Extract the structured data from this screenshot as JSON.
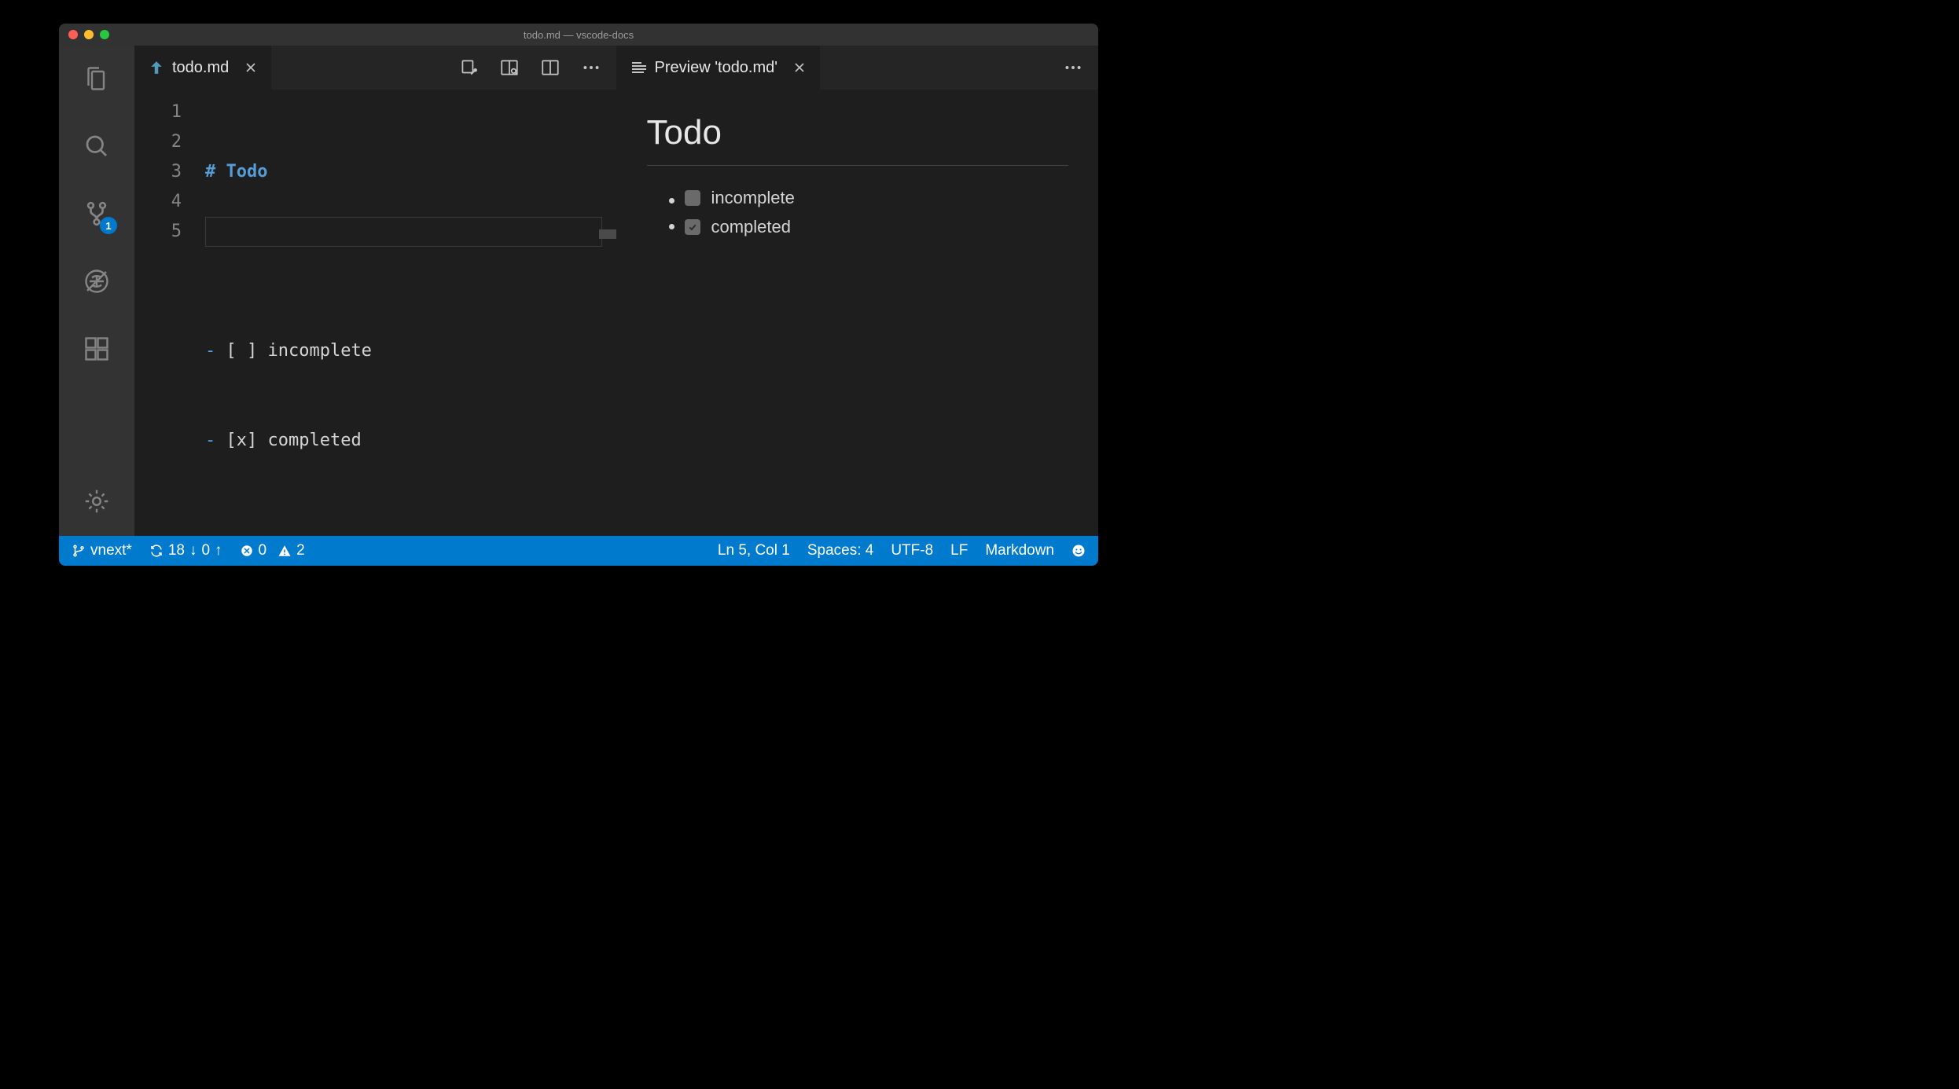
{
  "window": {
    "title": "todo.md — vscode-docs"
  },
  "activity": {
    "scm_badge": "1"
  },
  "left_pane": {
    "tab": {
      "label": "todo.md"
    },
    "lines": [
      {
        "num": "1",
        "prefix": "# ",
        "text": "Todo",
        "heading": true
      },
      {
        "num": "2",
        "prefix": "",
        "text": ""
      },
      {
        "num": "3",
        "prefix": "- ",
        "text": "[ ] incomplete"
      },
      {
        "num": "4",
        "prefix": "- ",
        "text": "[x] completed"
      },
      {
        "num": "5",
        "prefix": "",
        "text": ""
      }
    ]
  },
  "right_pane": {
    "tab": {
      "label": "Preview 'todo.md'"
    },
    "heading": "Todo",
    "items": [
      {
        "checked": false,
        "label": "incomplete"
      },
      {
        "checked": true,
        "label": "completed"
      }
    ]
  },
  "status": {
    "branch": "vnext*",
    "sync_incoming": "18",
    "sync_outgoing": "0",
    "errors": "0",
    "warnings": "2",
    "cursor": "Ln 5, Col 1",
    "indent": "Spaces: 4",
    "encoding": "UTF-8",
    "eol": "LF",
    "language": "Markdown"
  }
}
